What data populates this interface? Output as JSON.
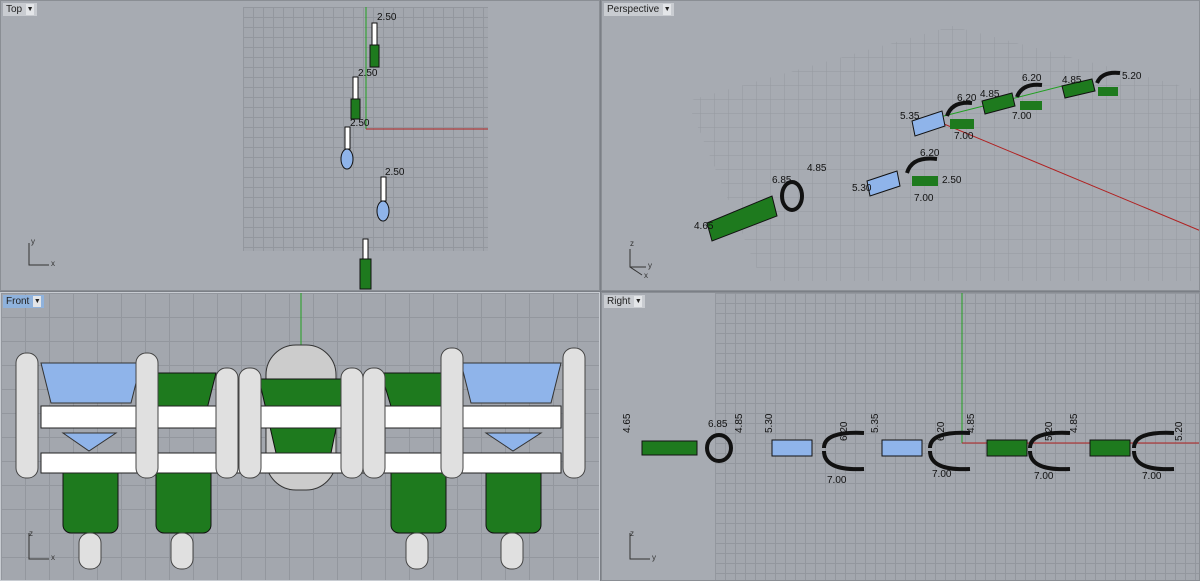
{
  "viewports": {
    "top": {
      "label": "Top",
      "dims": [
        "2.50",
        "2.50",
        "2.50",
        "2.50"
      ],
      "axes": [
        "y",
        "x"
      ]
    },
    "perspective": {
      "label": "Perspective",
      "dims": [
        "6.85",
        "4.85",
        "4.65",
        "5.30",
        "6.20",
        "2.50",
        "7.00",
        "5.35",
        "6.20",
        "7.00",
        "4.85",
        "6.20",
        "7.00",
        "4.85",
        "5.20"
      ],
      "axes": [
        "z",
        "y",
        "x"
      ]
    },
    "front": {
      "label": "Front",
      "axes": [
        "z",
        "x"
      ]
    },
    "right": {
      "label": "Right",
      "dims": [
        "4.65",
        "6.85",
        "4.85",
        "5.30",
        "6.20",
        "7.00",
        "5.35",
        "6.20",
        "7.00",
        "4.85",
        "5.20",
        "7.00",
        "4.85",
        "5.20",
        "7.00"
      ],
      "axes": [
        "z",
        "y"
      ]
    }
  },
  "colors": {
    "green": "#1e7a1e",
    "blue": "#8fb4ea",
    "grid_x": "#b02020",
    "grid_y": "#20a020"
  }
}
